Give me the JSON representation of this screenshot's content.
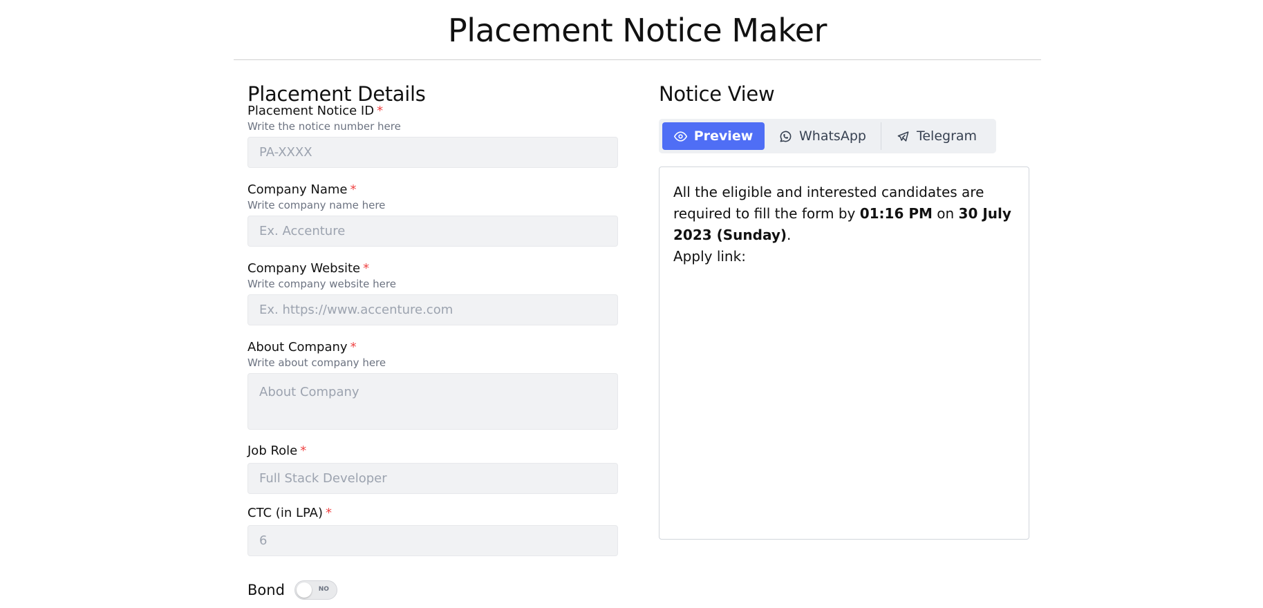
{
  "app": {
    "title": "Placement Notice Maker"
  },
  "form": {
    "heading": "Placement Details",
    "required_marker": "*",
    "fields": [
      {
        "label": "Placement Notice ID",
        "hint": "Write the notice number here",
        "placeholder": "PA-XXXX"
      },
      {
        "label": "Company Name",
        "hint": "Write company name here",
        "placeholder": "Ex. Accenture"
      },
      {
        "label": "Company Website",
        "hint": "Write company website here",
        "placeholder": "Ex. https://www.accenture.com"
      },
      {
        "label": "About Company",
        "hint": "Write about company here",
        "placeholder": "About Company"
      },
      {
        "label": "Job Role",
        "placeholder": "Full Stack Developer"
      },
      {
        "label": "CTC (in LPA)",
        "placeholder": "6"
      }
    ],
    "bond": {
      "label": "Bond",
      "toggle_text": "NO",
      "value": false
    }
  },
  "notice": {
    "heading": "Notice View",
    "tabs": [
      {
        "label": "Preview",
        "icon": "eye-icon",
        "active": true
      },
      {
        "label": "WhatsApp",
        "icon": "whatsapp-icon",
        "active": false
      },
      {
        "label": "Telegram",
        "icon": "paper-plane-icon",
        "active": false
      }
    ],
    "preview": {
      "text1": "All the eligible and interested candidates are required to fill the form by ",
      "time": "01:16 PM",
      "text2": " on ",
      "date": "30 July 2023 (Sunday)",
      "text3": ".",
      "apply_label": "Apply link:"
    }
  },
  "colors": {
    "accent": "#4f6ef5",
    "required": "#ef4444",
    "input_bg": "#f1f2f4"
  }
}
